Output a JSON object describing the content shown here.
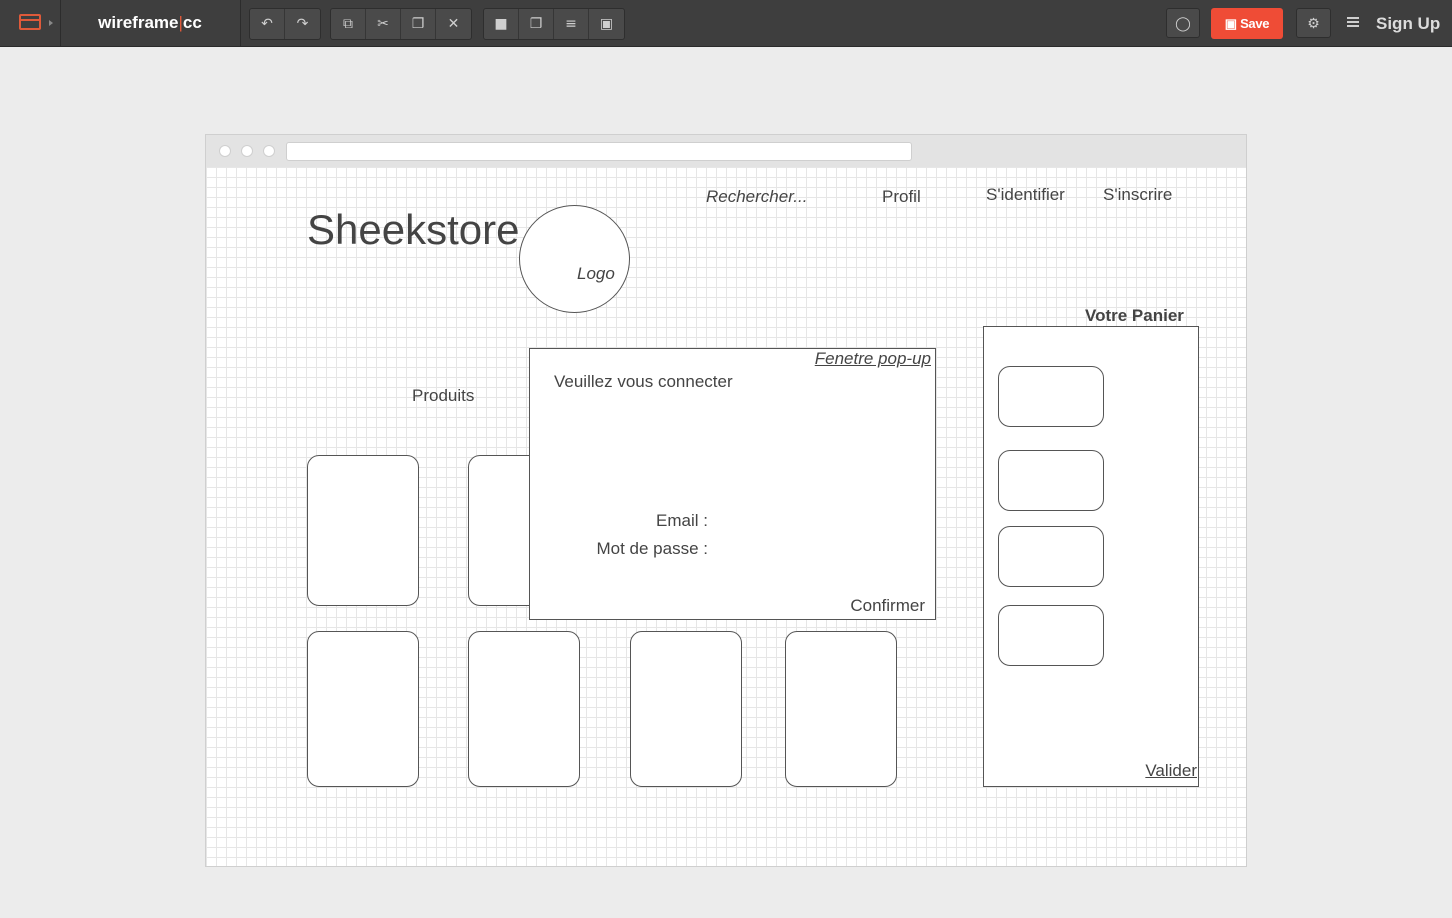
{
  "app": {
    "brand_left": "wireframe",
    "brand_sep": "|",
    "brand_right": "cc",
    "save_label": "Save",
    "signup_label": "Sign Up",
    "accent_color": "#ef4c36",
    "toolbar_color": "#3e3e3e"
  },
  "toolbar": {
    "groups": [
      [
        {
          "name": "undo-icon"
        },
        {
          "name": "redo-icon"
        }
      ],
      [
        {
          "name": "duplicate-icon"
        },
        {
          "name": "cut-icon"
        },
        {
          "name": "paste-icon"
        },
        {
          "name": "delete-icon"
        }
      ],
      [
        {
          "name": "lock-icon"
        },
        {
          "name": "bring-to-front-icon"
        },
        {
          "name": "align-icon"
        },
        {
          "name": "group-icon"
        }
      ]
    ]
  },
  "wireframe": {
    "site_title": "Sheekstore",
    "logo_label": "Logo",
    "nav": {
      "search": "Rechercher...",
      "profile": "Profil",
      "login": "S'identifier",
      "register": "S'inscrire"
    },
    "products_label": "Produits",
    "popup": {
      "caption": "Fenetre pop-up",
      "message": "Veuillez vous connecter",
      "email_label": "Email :",
      "password_label": "Mot de passe :",
      "confirm_label": "Confirmer"
    },
    "cart": {
      "title": "Votre Panier",
      "validate_label": "Valider"
    }
  }
}
